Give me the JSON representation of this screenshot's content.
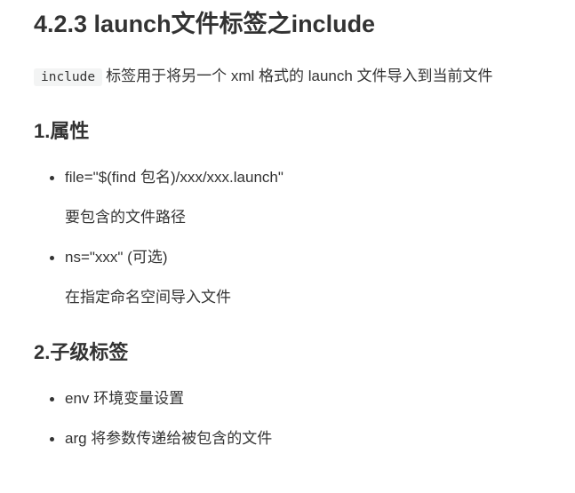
{
  "title": "4.2.3 launch文件标签之include",
  "intro": {
    "code": "include",
    "text": "标签用于将另一个 xml 格式的 launch 文件导入到当前文件"
  },
  "sections": {
    "attributes": {
      "heading": "1.属性",
      "items": [
        {
          "text": "file=\"$(find 包名)/xxx/xxx.launch\"",
          "desc": "要包含的文件路径"
        },
        {
          "text": "ns=\"xxx\" (可选)",
          "desc": "在指定命名空间导入文件"
        }
      ]
    },
    "children": {
      "heading": "2.子级标签",
      "items": [
        {
          "text": "env 环境变量设置"
        },
        {
          "text": "arg 将参数传递给被包含的文件"
        }
      ]
    }
  }
}
